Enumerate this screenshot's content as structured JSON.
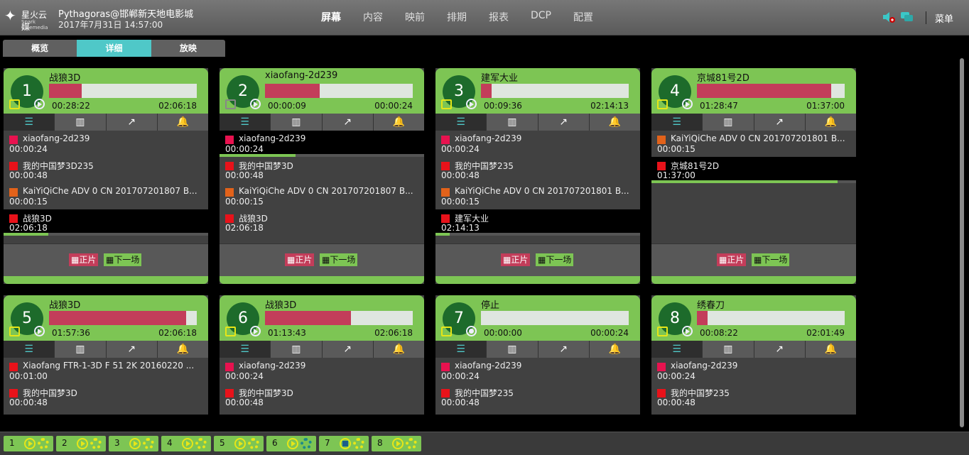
{
  "header": {
    "logo_text": "星火云媒",
    "logo_sub": "Spark Cinemedia",
    "user": "Pythagoras@邯郸新天地电影城",
    "datetime": "2017年7月31日 14:57:00",
    "nav": [
      {
        "label": "屏幕",
        "active": true
      },
      {
        "label": "内容",
        "active": false
      },
      {
        "label": "映前",
        "active": false
      },
      {
        "label": "排期",
        "active": false
      },
      {
        "label": "报表",
        "active": false
      },
      {
        "label": "DCP",
        "active": false
      },
      {
        "label": "配置",
        "active": false
      }
    ],
    "menu_label": "菜单",
    "icons": [
      "speaker-alert-icon",
      "chat-icon"
    ]
  },
  "view_tabs": [
    {
      "label": "概览",
      "active": false
    },
    {
      "label": "详细",
      "active": true
    },
    {
      "label": "放映",
      "active": false
    }
  ],
  "screens": [
    {
      "num": "1",
      "title": "战狼3D",
      "progress": 0.22,
      "elapsed": "00:28:22",
      "total": "02:06:18",
      "items": [
        {
          "name": "xiaofang-2d239",
          "dur": "00:00:24",
          "color": "#e8124f"
        },
        {
          "name": "我的中国梦3D235",
          "dur": "00:00:48",
          "color": "#e8121a"
        },
        {
          "name": "KaiYiQiChe ADV 0 CN 201707201807 B...",
          "dur": "00:00:15",
          "color": "#e2621a"
        },
        {
          "name": "战狼3D",
          "dur": "02:06:18",
          "color": "#e8121a",
          "current": true,
          "progress": 0.22
        }
      ],
      "main_btn": "正片",
      "next_btn": "下一场"
    },
    {
      "num": "2",
      "title": "xiaofang-2d239",
      "progress": 0.37,
      "elapsed": "00:00:09",
      "total": "00:00:24",
      "items": [
        {
          "name": "xiaofang-2d239",
          "dur": "00:00:24",
          "color": "#e8124f",
          "current": true,
          "progress": 0.37
        },
        {
          "name": "我的中国梦3D",
          "dur": "00:00:48",
          "color": "#e8121a"
        },
        {
          "name": "KaiYiQiChe ADV 0 CN 201707201807 B...",
          "dur": "00:00:15",
          "color": "#e2621a"
        },
        {
          "name": "战狼3D",
          "dur": "02:06:18",
          "color": "#e8121a"
        }
      ],
      "main_btn": "正片",
      "next_btn": "下一场"
    },
    {
      "num": "3",
      "title": "建军大业",
      "progress": 0.07,
      "elapsed": "00:09:36",
      "total": "02:14:13",
      "items": [
        {
          "name": "xiaofang-2d239",
          "dur": "00:00:24",
          "color": "#e8124f"
        },
        {
          "name": "我的中国梦235",
          "dur": "00:00:48",
          "color": "#e8121a"
        },
        {
          "name": "KaiYiQiChe ADV 0 CN 201707201801 B...",
          "dur": "00:00:15",
          "color": "#e2621a"
        },
        {
          "name": "建军大业",
          "dur": "02:14:13",
          "color": "#e8121a",
          "current": true,
          "progress": 0.07
        }
      ],
      "main_btn": "正片",
      "next_btn": "下一场"
    },
    {
      "num": "4",
      "title": "京城81号2D",
      "progress": 0.91,
      "elapsed": "01:28:47",
      "total": "01:37:00",
      "items": [
        {
          "name": "KaiYiQiChe ADV 0 CN 201707201801 B...",
          "dur": "00:00:15",
          "color": "#e2621a"
        },
        {
          "name": "京城81号2D",
          "dur": "01:37:00",
          "color": "#e8121a",
          "current": true,
          "progress": 0.91
        }
      ],
      "main_btn": "正片",
      "next_btn": "下一场"
    },
    {
      "num": "5",
      "title": "战狼3D",
      "progress": 0.93,
      "elapsed": "01:57:36",
      "total": "02:06:18",
      "items": [
        {
          "name": "Xiaofang FTR-1-3D F 51 2K 20160220 ...",
          "dur": "00:01:00",
          "color": "#e8121a"
        },
        {
          "name": "我的中国梦3D",
          "dur": "00:00:48",
          "color": "#e8121a"
        }
      ]
    },
    {
      "num": "6",
      "title": "战狼3D",
      "progress": 0.58,
      "elapsed": "01:13:43",
      "total": "02:06:18",
      "items": [
        {
          "name": "xiaofang-2d239",
          "dur": "00:00:24",
          "color": "#e8124f"
        },
        {
          "name": "我的中国梦3D",
          "dur": "00:00:48",
          "color": "#e8121a"
        }
      ]
    },
    {
      "num": "7",
      "title": "停止",
      "progress": 0,
      "elapsed": "00:00:00",
      "total": "00:00:24",
      "stopped": true,
      "items": [
        {
          "name": "xiaofang-2d239",
          "dur": "00:00:24",
          "color": "#e8124f"
        },
        {
          "name": "我的中国梦235",
          "dur": "00:00:48",
          "color": "#e8121a"
        }
      ]
    },
    {
      "num": "8",
      "title": "绣春刀",
      "progress": 0.07,
      "elapsed": "00:08:22",
      "total": "02:01:49",
      "items": [
        {
          "name": "xiaofang-2d239",
          "dur": "00:00:24",
          "color": "#e8124f"
        },
        {
          "name": "我的中国梦235",
          "dur": "00:00:48",
          "color": "#e8121a"
        }
      ]
    }
  ],
  "tool_icons": [
    "playlist-icon",
    "mixer-icon",
    "export-icon",
    "bell-icon"
  ],
  "bottom_chips": [
    {
      "num": "1",
      "state": "play"
    },
    {
      "num": "2",
      "state": "play"
    },
    {
      "num": "3",
      "state": "play"
    },
    {
      "num": "4",
      "state": "play"
    },
    {
      "num": "5",
      "state": "play"
    },
    {
      "num": "6",
      "state": "play-alt"
    },
    {
      "num": "7",
      "state": "stop"
    },
    {
      "num": "8",
      "state": "play"
    }
  ]
}
